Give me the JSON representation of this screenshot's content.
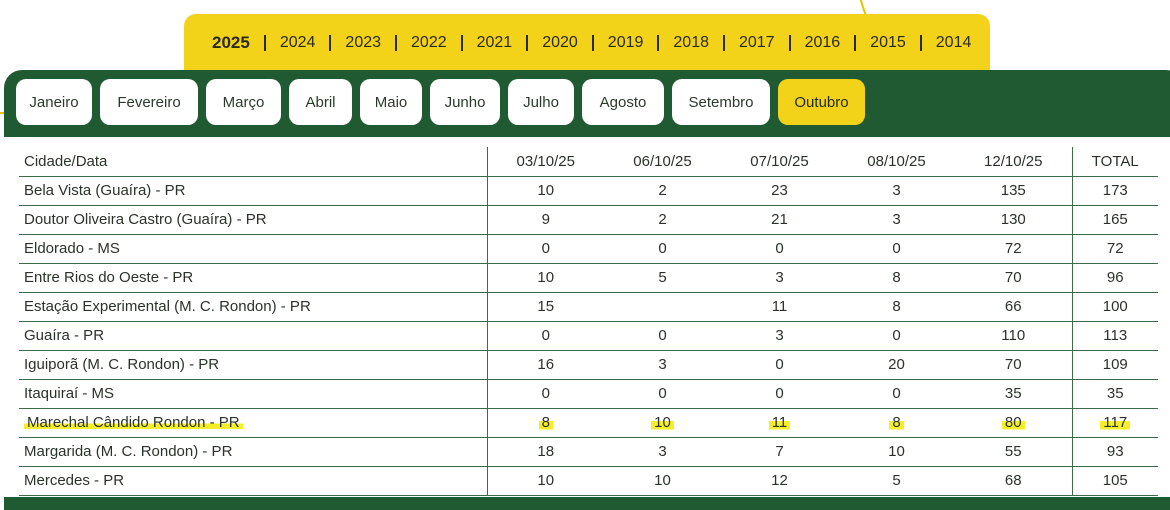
{
  "years": [
    "2025",
    "2024",
    "2023",
    "2022",
    "2021",
    "2020",
    "2019",
    "2018",
    "2017",
    "2016",
    "2015",
    "2014"
  ],
  "active_year": "2025",
  "months": [
    "Janeiro",
    "Fevereiro",
    "Março",
    "Abril",
    "Maio",
    "Junho",
    "Julho",
    "Agosto",
    "Setembro",
    "Outubro"
  ],
  "active_month": "Outubro",
  "colors": {
    "green": "#1f5a32",
    "yellow": "#f3d21a",
    "highlight": "#f5ee28"
  },
  "table": {
    "headers": [
      "Cidade/Data",
      "03/10/25",
      "06/10/25",
      "07/10/25",
      "08/10/25",
      "12/10/25",
      "TOTAL"
    ],
    "rows": [
      [
        "Bela Vista (Guaíra) - PR",
        "10",
        "2",
        "23",
        "3",
        "135",
        "173"
      ],
      [
        "Doutor Oliveira Castro (Guaíra) - PR",
        "9",
        "2",
        "21",
        "3",
        "130",
        "165"
      ],
      [
        "Eldorado - MS",
        "0",
        "0",
        "0",
        "0",
        "72",
        "72"
      ],
      [
        "Entre Rios do Oeste - PR",
        "10",
        "5",
        "3",
        "8",
        "70",
        "96"
      ],
      [
        "Estação Experimental (M. C. Rondon) - PR",
        "15",
        "",
        "11",
        "8",
        "66",
        "100"
      ],
      [
        "Guaíra - PR",
        "0",
        "0",
        "3",
        "0",
        "110",
        "113"
      ],
      [
        "Iguiporã (M. C. Rondon) - PR",
        "16",
        "3",
        "0",
        "20",
        "70",
        "109"
      ],
      [
        "Itaquiraí - MS",
        "0",
        "0",
        "0",
        "0",
        "35",
        "35"
      ],
      [
        "Marechal Cândido Rondon - PR",
        "8",
        "10",
        "11",
        "8",
        "80",
        "117"
      ],
      [
        "Margarida (M. C. Rondon) - PR",
        "18",
        "3",
        "7",
        "10",
        "55",
        "93"
      ],
      [
        "Mercedes - PR",
        "10",
        "10",
        "12",
        "5",
        "68",
        "105"
      ]
    ],
    "highlighted_row": "Marechal Cândido Rondon - PR"
  }
}
